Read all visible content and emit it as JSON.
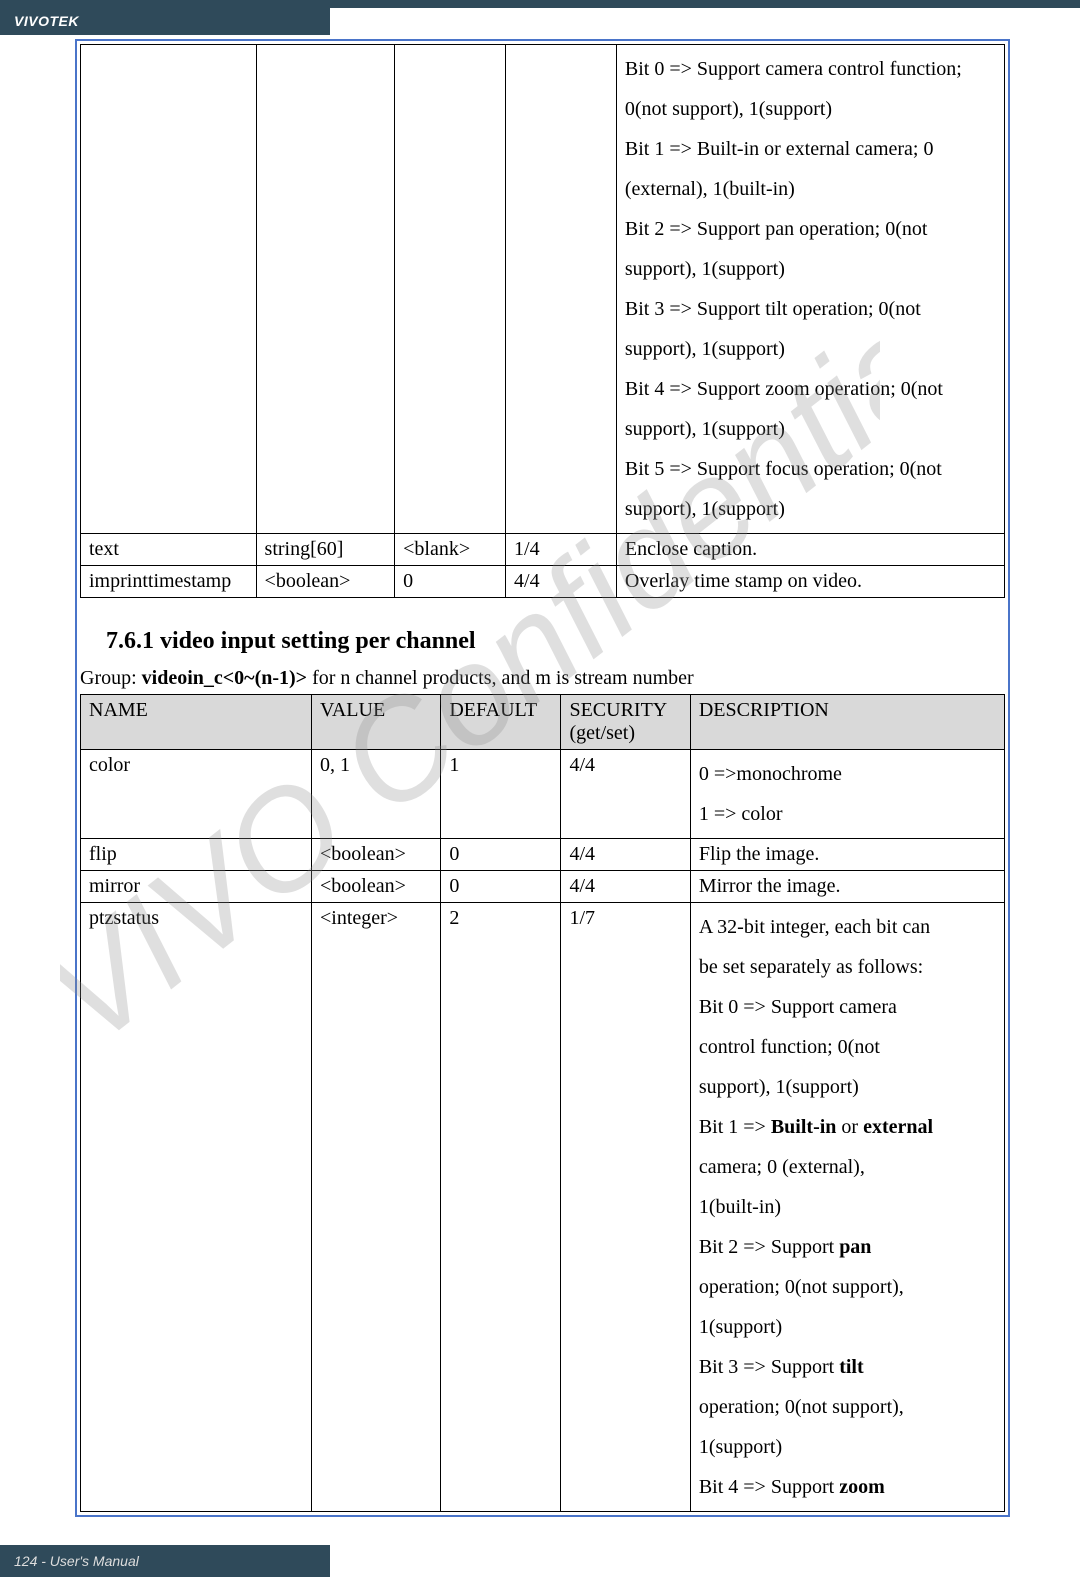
{
  "header": {
    "brand": "VIVOTEK"
  },
  "footer": {
    "page": "124 - User's Manual"
  },
  "section": {
    "title": "7.6.1 video input setting per channel",
    "group_prefix": "Group: ",
    "group_bold": "videoin_c<0~(n-1)>",
    "group_suffix": " for n channel products, and m is stream number"
  },
  "table1": {
    "rows": [
      {
        "name": "",
        "value": "",
        "default": "",
        "security": "",
        "desc": "Bit 0 => Support camera control function; 0(not support), 1(support)\nBit 1 => Built-in or external camera; 0 (external), 1(built-in)\nBit 2 => Support pan operation; 0(not support), 1(support)\nBit 3 => Support tilt operation; 0(not support), 1(support)\nBit 4 => Support zoom operation; 0(not support), 1(support)\nBit 5 => Support focus operation; 0(not support), 1(support)"
      },
      {
        "name": "text",
        "value": "string[60]",
        "default": "<blank>",
        "security": "1/4",
        "desc": "Enclose caption."
      },
      {
        "name": "imprinttimestamp",
        "value": "<boolean>",
        "default": "0",
        "security": "4/4",
        "desc": "Overlay time stamp on video."
      }
    ]
  },
  "table2": {
    "headers": {
      "name": "NAME",
      "value": "VALUE",
      "default": "DEFAULT",
      "security": "SECURITY (get/set)",
      "desc": "DESCRIPTION"
    },
    "rows": [
      {
        "name": "color",
        "value": "0, 1",
        "default": "1",
        "security": "4/4",
        "desc": "0 =>monochrome\n1 => color"
      },
      {
        "name": "flip",
        "value": "<boolean>",
        "default": "0",
        "security": "4/4",
        "desc": "Flip the image."
      },
      {
        "name": "mirror",
        "value": "<boolean>",
        "default": "0",
        "security": "4/4",
        "desc": "Mirror the image."
      },
      {
        "name": "ptzstatus",
        "value": "<integer>",
        "default": "2",
        "security": "1/7",
        "desc": ""
      }
    ],
    "ptz_lines": [
      "A 32-bit integer, each bit can",
      "be set separately as follows:",
      "Bit 0 => Support camera",
      "control function; 0(not",
      "support), 1(support)",
      {
        "pre": "Bit 1 => ",
        "bold1": "Built-in",
        "mid": " or ",
        "bold2": "external"
      },
      "camera; 0 (external),",
      "1(built-in)",
      {
        "pre": "Bit 2 => Support ",
        "bold1": "pan"
      },
      "operation; 0(not support),",
      "1(support)",
      {
        "pre": "Bit 3 => Support ",
        "bold1": "tilt"
      },
      "operation; 0(not support),",
      "1(support)",
      {
        "pre": "Bit 4 => Support ",
        "bold1": "zoom"
      }
    ]
  }
}
